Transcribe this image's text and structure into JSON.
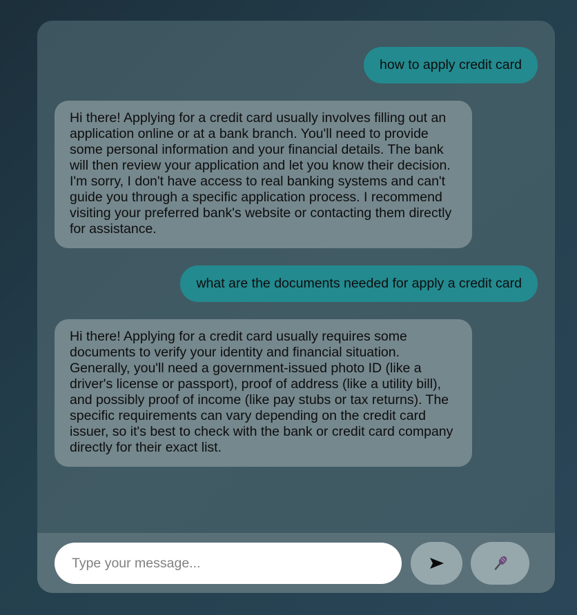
{
  "chat": {
    "messages": [
      {
        "role": "user",
        "text": "how to apply credit card"
      },
      {
        "role": "bot",
        "text": "Hi there! Applying for a credit card usually involves filling out an application online or at a bank branch. You'll need to provide some personal information and your financial details. The bank will then review your application and let you know their decision. I'm sorry, I don't have access to real banking systems and can't guide you through a specific application process. I recommend visiting your preferred bank's website or contacting them directly for assistance."
      },
      {
        "role": "user",
        "text": "what are the documents needed for apply a credit card"
      },
      {
        "role": "bot",
        "text": "Hi there! Applying for a credit card usually requires some documents to verify your identity and financial situation. Generally, you'll need a government-issued photo ID (like a driver's license or passport), proof of address (like a utility bill), and possibly proof of income (like pay stubs or tax returns). The specific requirements can vary depending on the credit card issuer, so it's best to check with the bank or credit card company directly for their exact list."
      }
    ]
  },
  "input_bar": {
    "placeholder": "Type your message...",
    "value": "",
    "send_icon": "send-arrow-icon",
    "mic_icon": "microphone-icon"
  },
  "colors": {
    "user_bubble": "#238a8f",
    "bot_bubble": "#75888e",
    "input_bar": "#5a7078",
    "button": "#97a8ac"
  }
}
